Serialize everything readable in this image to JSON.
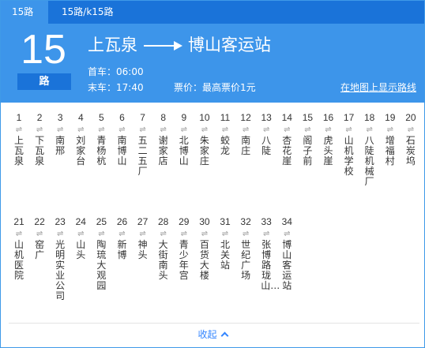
{
  "tabs": [
    {
      "label": "15路"
    },
    {
      "label": "15路/k15路"
    }
  ],
  "line": {
    "number": "15",
    "unit": "路",
    "from": "上瓦泉",
    "to": "博山客运站",
    "first_bus": "首车：06:00",
    "last_bus": "末车：17:40",
    "fare": "票价：最高票价1元",
    "map_link": "在地图上显示路线"
  },
  "stops": [
    {
      "no": "1",
      "name": "上瓦泉"
    },
    {
      "no": "2",
      "name": "下瓦泉"
    },
    {
      "no": "3",
      "name": "南邢"
    },
    {
      "no": "4",
      "name": "刘家台"
    },
    {
      "no": "5",
      "name": "青杨杭"
    },
    {
      "no": "6",
      "name": "南博山"
    },
    {
      "no": "7",
      "name": "五二五厂"
    },
    {
      "no": "8",
      "name": "谢家店"
    },
    {
      "no": "9",
      "name": "北博山"
    },
    {
      "no": "10",
      "name": "朱家庄"
    },
    {
      "no": "11",
      "name": "蛟龙"
    },
    {
      "no": "12",
      "name": "南庄"
    },
    {
      "no": "13",
      "name": "八陡"
    },
    {
      "no": "14",
      "name": "杏花崖"
    },
    {
      "no": "15",
      "name": "阁子前"
    },
    {
      "no": "16",
      "name": "虎头崖"
    },
    {
      "no": "17",
      "name": "山机学校"
    },
    {
      "no": "18",
      "name": "八陡机械厂"
    },
    {
      "no": "19",
      "name": "增福村"
    },
    {
      "no": "20",
      "name": "石炭坞"
    },
    {
      "no": "21",
      "name": "山机医院"
    },
    {
      "no": "22",
      "name": "窑广"
    },
    {
      "no": "23",
      "name": "光明实业公司"
    },
    {
      "no": "24",
      "name": "山头"
    },
    {
      "no": "25",
      "name": "陶琉大观园"
    },
    {
      "no": "26",
      "name": "新博"
    },
    {
      "no": "27",
      "name": "神头"
    },
    {
      "no": "28",
      "name": "大街南头"
    },
    {
      "no": "29",
      "name": "青少年宫"
    },
    {
      "no": "30",
      "name": "百货大楼"
    },
    {
      "no": "31",
      "name": "北关站"
    },
    {
      "no": "32",
      "name": "世纪广场"
    },
    {
      "no": "33",
      "name": "张博路珑山…"
    },
    {
      "no": "34",
      "name": "博山客运站"
    }
  ],
  "stop_separator": "⇌",
  "collapse_label": "收起",
  "icons": {
    "collapse": "chevron-up-icon",
    "route_arrow": "long-arrow-right-icon",
    "stop_swap": "swap-arrows-icon"
  },
  "colors": {
    "header": "#3d95ea",
    "tabbar": "#1a73d9",
    "link": "#3385ff"
  }
}
